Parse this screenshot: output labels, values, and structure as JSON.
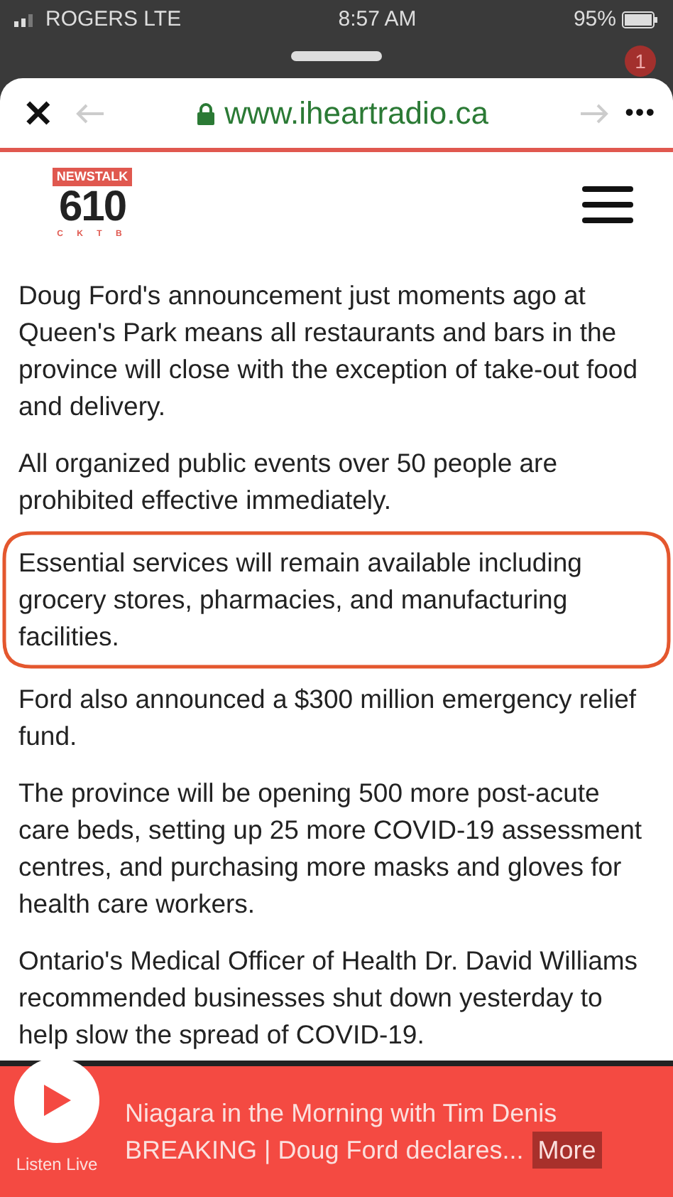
{
  "status_bar": {
    "carrier": "ROGERS  LTE",
    "time": "8:57 AM",
    "battery": "95%"
  },
  "background_badge": "1",
  "browser_bar": {
    "close": "✕",
    "url": "www.iheartradio.ca",
    "menu": "•••"
  },
  "site_header": {
    "logo_top": "NEWSTALK",
    "logo_number": "610",
    "logo_letters": "C K T B"
  },
  "article": {
    "paragraphs": [
      {
        "text": "Doug Ford's announcement just moments ago at Queen's Park means all restaurants and bars in the province will close with the exception of take-out food and delivery.",
        "circled": false
      },
      {
        "text": "All organized public events over 50 people are prohibited effective immediately.",
        "circled": false
      },
      {
        "text": "Essential services will remain available including grocery stores, pharmacies, and manufacturing facilities.",
        "circled": true
      },
      {
        "text": "Ford also announced a $300 million emergency relief fund.",
        "circled": false
      },
      {
        "text": "The province will be opening 500 more post-acute care beds, setting up 25 more COVID-19 assessment centres, and purchasing more masks and gloves for health care workers.",
        "circled": false
      },
      {
        "text": "Ontario's Medical Officer of Health Dr. David Williams recommended businesses shut down yesterday to help slow the spread of COVID-19.",
        "circled": false
      }
    ]
  },
  "player": {
    "listen_label": "Listen Live",
    "show": "Niagara in the Morning with Tim Denis",
    "headline": "BREAKING | Doug Ford declares...",
    "more": "More"
  }
}
